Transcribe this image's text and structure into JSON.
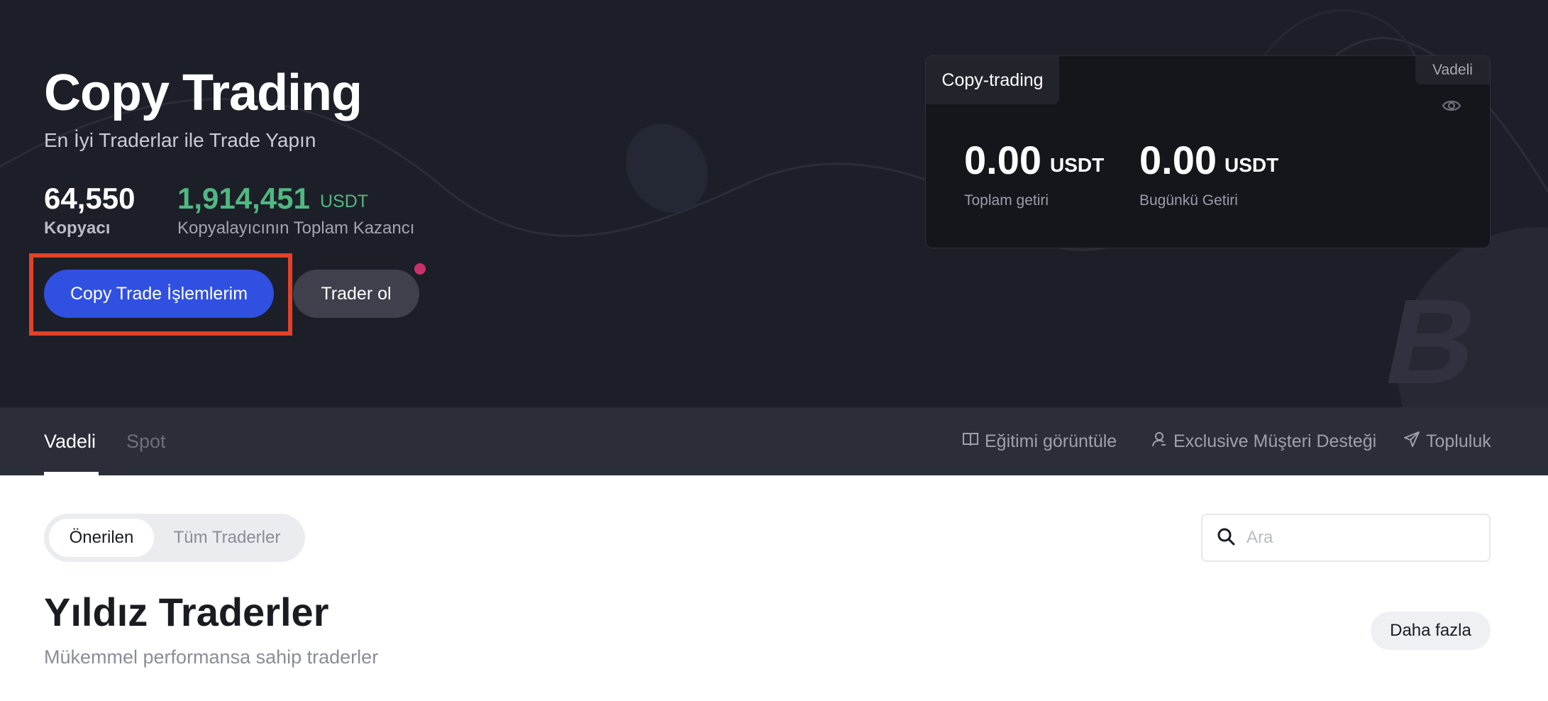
{
  "hero": {
    "title": "Copy Trading",
    "subtitle": "En İyi Traderlar ile Trade Yapın",
    "stats": {
      "copiers_value": "64,550",
      "copiers_label": "Kopyacı",
      "profit_value": "1,914,451",
      "profit_unit": "USDT",
      "profit_label": "Kopyalayıcının Toplam Kazancı"
    },
    "primary_button": "Copy Trade İşlemlerim",
    "secondary_button": "Trader ol"
  },
  "account_card": {
    "tab_label": "Copy-trading",
    "badge": "Vadeli",
    "total_return": {
      "value": "0.00",
      "unit": "USDT",
      "label": "Toplam getiri"
    },
    "today_return": {
      "value": "0.00",
      "unit": "USDT",
      "label": "Bugünkü Getiri"
    }
  },
  "nav": {
    "tabs": [
      {
        "label": "Vadeli",
        "active": true
      },
      {
        "label": "Spot",
        "active": false
      }
    ],
    "links": [
      {
        "label": "Eğitimi görüntüle",
        "icon": "book-icon"
      },
      {
        "label": "Exclusive Müşteri Desteği",
        "icon": "user-support-icon"
      },
      {
        "label": "Topluluk",
        "icon": "send-icon"
      }
    ]
  },
  "filters": {
    "options": [
      "Önerilen",
      "Tüm Traderler"
    ],
    "selected": "Önerilen"
  },
  "search": {
    "placeholder": "Ara"
  },
  "section": {
    "title": "Yıldız Traderler",
    "subtitle": "Mükemmel performansa sahip traderler",
    "more_button": "Daha fazla"
  },
  "colors": {
    "hero_bg": "#1d1f28",
    "accent_blue": "#3050e2",
    "profit_green": "#4fb982",
    "highlight_red": "#e34128",
    "notification_dot": "#c8326b"
  }
}
